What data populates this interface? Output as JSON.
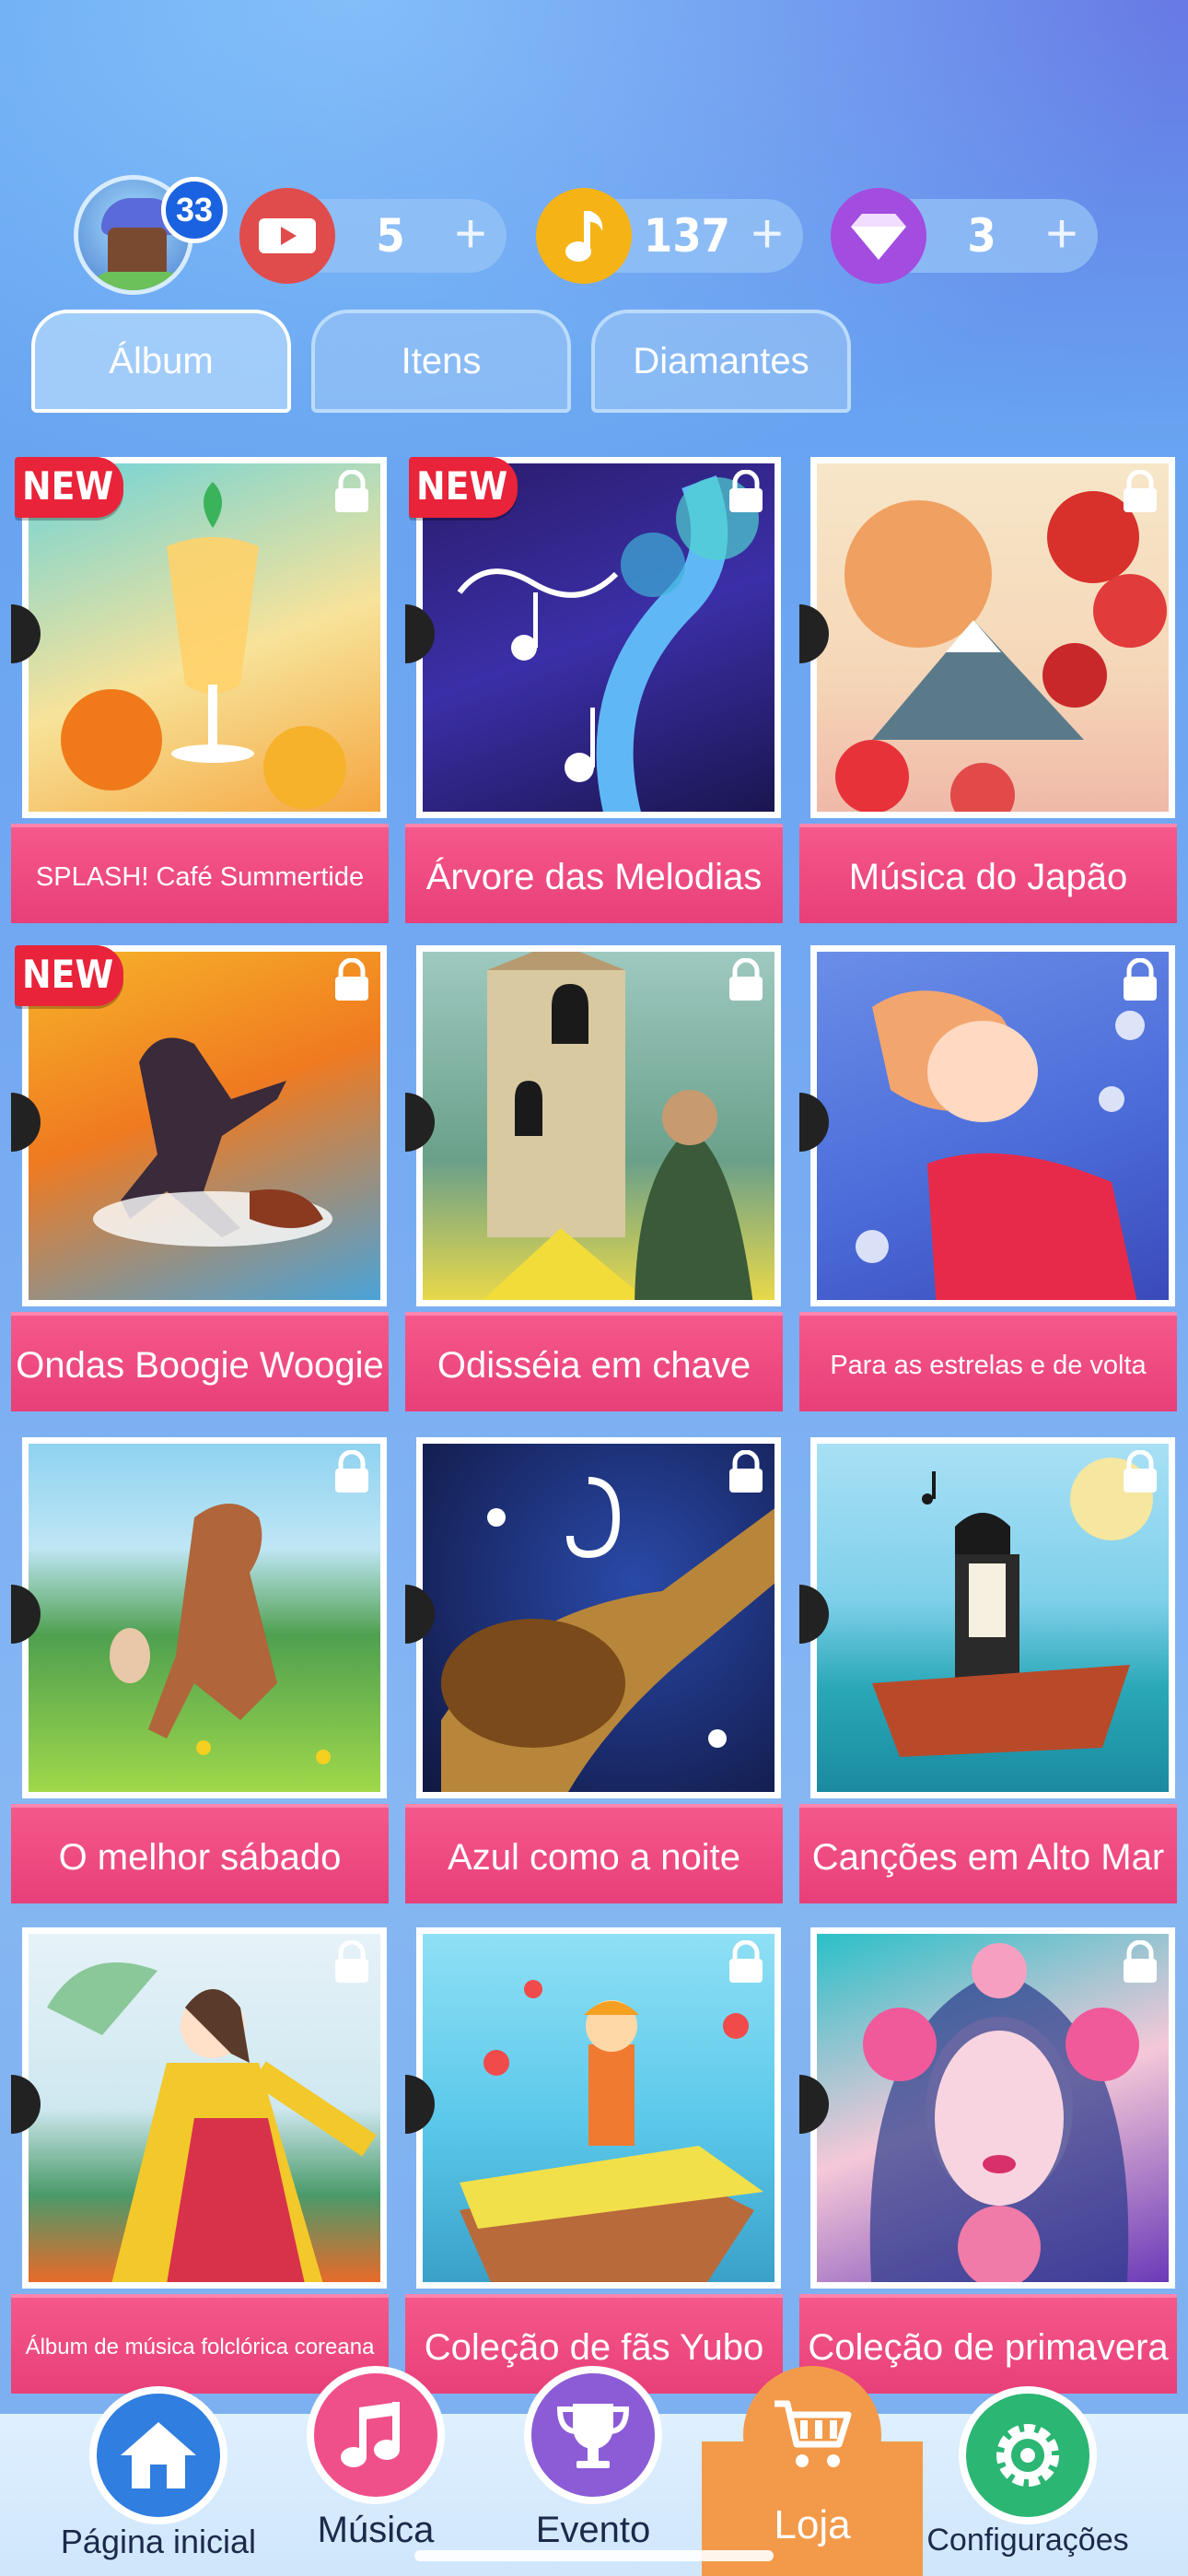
{
  "status": {
    "level": "33",
    "tickets": "5",
    "notes": "137",
    "diamonds": "3",
    "plus": "+"
  },
  "tabs": [
    {
      "label": "Álbum",
      "active": true
    },
    {
      "label": "Itens",
      "active": false
    },
    {
      "label": "Diamantes",
      "active": false
    }
  ],
  "new_badge": "NEW",
  "albums": [
    {
      "title": "SPLASH! Café Summertide",
      "new": true
    },
    {
      "title": "Árvore das Melodias",
      "new": true
    },
    {
      "title": "Música do Japão",
      "new": false
    },
    {
      "title": "Ondas Boogie Woogie",
      "new": true
    },
    {
      "title": "Odisséia em chave",
      "new": false
    },
    {
      "title": "Para as estrelas e de volta",
      "new": false
    },
    {
      "title": "O melhor sábado",
      "new": false
    },
    {
      "title": "Azul como a noite",
      "new": false
    },
    {
      "title": "Canções em Alto Mar",
      "new": false
    },
    {
      "title": "Álbum de música folclórica coreana",
      "new": false
    },
    {
      "title": "Coleção de fãs Yubo",
      "new": false
    },
    {
      "title": "Coleção de primavera",
      "new": false
    }
  ],
  "nav": [
    {
      "label": "Página inicial",
      "icon": "home-icon",
      "color": "#2f7ee0"
    },
    {
      "label": "Música",
      "icon": "music-note-icon",
      "color": "#f0508a"
    },
    {
      "label": "Evento",
      "icon": "trophy-icon",
      "color": "#8b5cd6"
    },
    {
      "label": "Loja",
      "icon": "cart-icon",
      "color": "#f39a4a",
      "active": true
    },
    {
      "label": "Configurações",
      "icon": "gear-icon",
      "color": "#2bb673"
    }
  ]
}
